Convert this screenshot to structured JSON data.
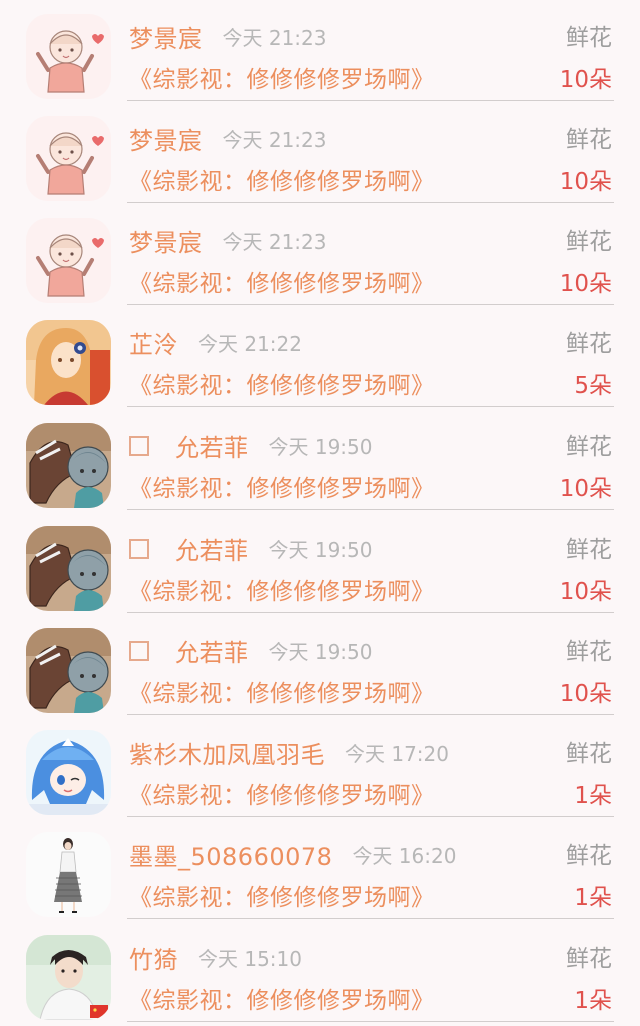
{
  "records": [
    {
      "name": "梦景宸",
      "time": "今天 21:23",
      "gift": "鲜花",
      "work": "《综影视：修修修修罗场啊》",
      "count": "10朵",
      "checkbox": false,
      "avatar": "chibi-girl-avatar"
    },
    {
      "name": "梦景宸",
      "time": "今天 21:23",
      "gift": "鲜花",
      "work": "《综影视：修修修修罗场啊》",
      "count": "10朵",
      "checkbox": false,
      "avatar": "chibi-girl-avatar"
    },
    {
      "name": "梦景宸",
      "time": "今天 21:23",
      "gift": "鲜花",
      "work": "《综影视：修修修修罗场啊》",
      "count": "10朵",
      "checkbox": false,
      "avatar": "chibi-girl-avatar"
    },
    {
      "name": "芷泠",
      "time": "今天 21:22",
      "gift": "鲜花",
      "work": "《综影视：修修修修罗场啊》",
      "count": "5朵",
      "checkbox": false,
      "avatar": "anime-kimono-girl-avatar"
    },
    {
      "name": "允若菲",
      "time": "今天 19:50",
      "gift": "鲜花",
      "work": "《综影视：修修修修罗场啊》",
      "count": "10朵",
      "checkbox": true,
      "avatar": "horse-cartoon-avatar"
    },
    {
      "name": "允若菲",
      "time": "今天 19:50",
      "gift": "鲜花",
      "work": "《综影视：修修修修罗场啊》",
      "count": "10朵",
      "checkbox": true,
      "avatar": "horse-cartoon-avatar"
    },
    {
      "name": "允若菲",
      "time": "今天 19:50",
      "gift": "鲜花",
      "work": "《综影视：修修修修罗场啊》",
      "count": "10朵",
      "checkbox": true,
      "avatar": "horse-cartoon-avatar"
    },
    {
      "name": "紫杉木加凤凰羽毛",
      "time": "今天 17:20",
      "gift": "鲜花",
      "work": "《综影视：修修修修罗场啊》",
      "count": "1朵",
      "checkbox": false,
      "avatar": "anime-blue-hair-avatar"
    },
    {
      "name": "墨墨_508660078",
      "time": "今天 16:20",
      "gift": "鲜花",
      "work": "《综影视：修修修修罗场啊》",
      "count": "1朵",
      "checkbox": false,
      "avatar": "fashion-woman-avatar"
    },
    {
      "name": "竹猗",
      "time": "今天 15:10",
      "gift": "鲜花",
      "work": "《综影视：修修修修罗场啊》",
      "count": "1朵",
      "checkbox": false,
      "avatar": "man-portrait-avatar"
    }
  ],
  "colors": {
    "name": "#ec8f5e",
    "count": "#e0524d",
    "gift": "#9e9e9e",
    "time": "#b7b7b7",
    "background": "#fcf7f8"
  }
}
